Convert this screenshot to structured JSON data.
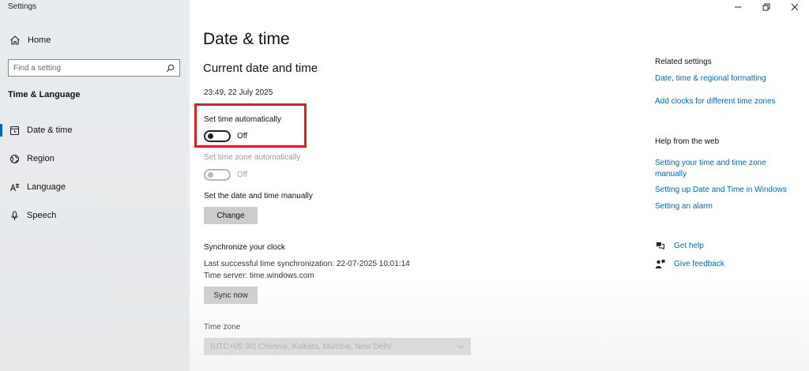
{
  "window": {
    "title": "Settings",
    "controls": {
      "minimize": "minimize-icon",
      "restore": "restore-icon",
      "close": "close-icon"
    }
  },
  "sidebar": {
    "home_label": "Home",
    "search_placeholder": "Find a setting",
    "section_title": "Time & Language",
    "items": [
      {
        "label": "Date & time",
        "icon": "clock-icon",
        "active": true
      },
      {
        "label": "Region",
        "icon": "globe-icon",
        "active": false
      },
      {
        "label": "Language",
        "icon": "language-icon",
        "active": false
      },
      {
        "label": "Speech",
        "icon": "microphone-icon",
        "active": false
      }
    ]
  },
  "main": {
    "title": "Date & time",
    "section_title": "Current date and time",
    "current_datetime": "23:49, 22 July 2025",
    "set_time_auto": {
      "label": "Set time automatically",
      "state": "Off",
      "on": false,
      "enabled": true
    },
    "set_timezone_auto": {
      "label": "Set time zone automatically",
      "state": "Off",
      "on": false,
      "enabled": false
    },
    "manual": {
      "label": "Set the date and time manually",
      "button": "Change"
    },
    "sync": {
      "heading": "Synchronize your clock",
      "last_sync": "Last successful time synchronization: 22-07-2025 10:01:14",
      "server": "Time server: time.windows.com",
      "button": "Sync now"
    },
    "timezone": {
      "heading": "Time zone",
      "value": "(UTC+05:30) Chennai, Kolkata, Mumbai, New Delhi"
    }
  },
  "related": {
    "heading": "Related settings",
    "links": [
      "Date, time & regional formatting",
      "Add clocks for different time zones"
    ]
  },
  "help_web": {
    "heading": "Help from the web",
    "links": [
      "Setting your time and time zone manually",
      "Setting up Date and Time in Windows",
      "Setting an alarm"
    ]
  },
  "help_actions": [
    {
      "label": "Get help",
      "icon": "help-chat-icon"
    },
    {
      "label": "Give feedback",
      "icon": "feedback-icon"
    }
  ],
  "colors": {
    "accent": "#0067c0",
    "highlight": "#e02020",
    "sidebar_bg": "#e8eaec"
  }
}
